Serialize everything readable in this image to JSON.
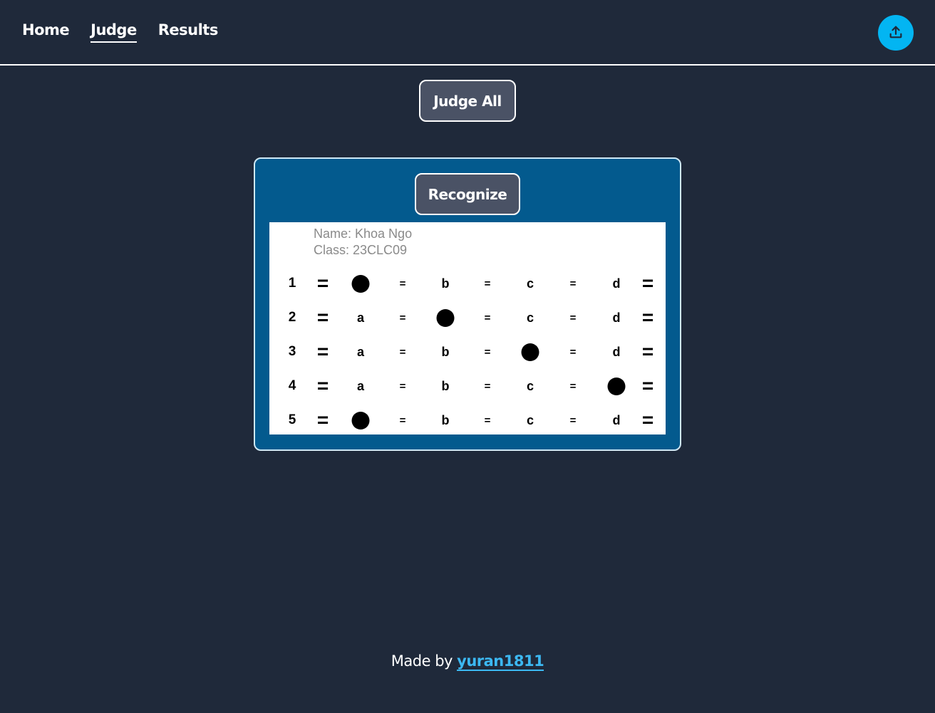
{
  "nav": {
    "items": [
      {
        "label": "Home",
        "active": false
      },
      {
        "label": "Judge",
        "active": true
      },
      {
        "label": "Results",
        "active": false
      }
    ],
    "upload_icon": "upload-icon"
  },
  "judge_all_label": "Judge All",
  "card": {
    "recognize_label": "Recognize",
    "sheet": {
      "name_line": "Name: Khoa Ngo",
      "class_line": "Class: 23CLC09",
      "options": [
        "a",
        "b",
        "c",
        "d"
      ],
      "questions": [
        {
          "number": "1",
          "filled": 0
        },
        {
          "number": "2",
          "filled": 1
        },
        {
          "number": "3",
          "filled": 2
        },
        {
          "number": "4",
          "filled": 3
        },
        {
          "number": "5",
          "filled": 0
        }
      ]
    }
  },
  "footer": {
    "prefix": "Made by ",
    "author": "yuran1811"
  },
  "colors": {
    "background": "#1f293a",
    "card": "#035a8e",
    "button": "#4a5265",
    "accent": "#03b5f2",
    "link": "#3cb8f2"
  }
}
